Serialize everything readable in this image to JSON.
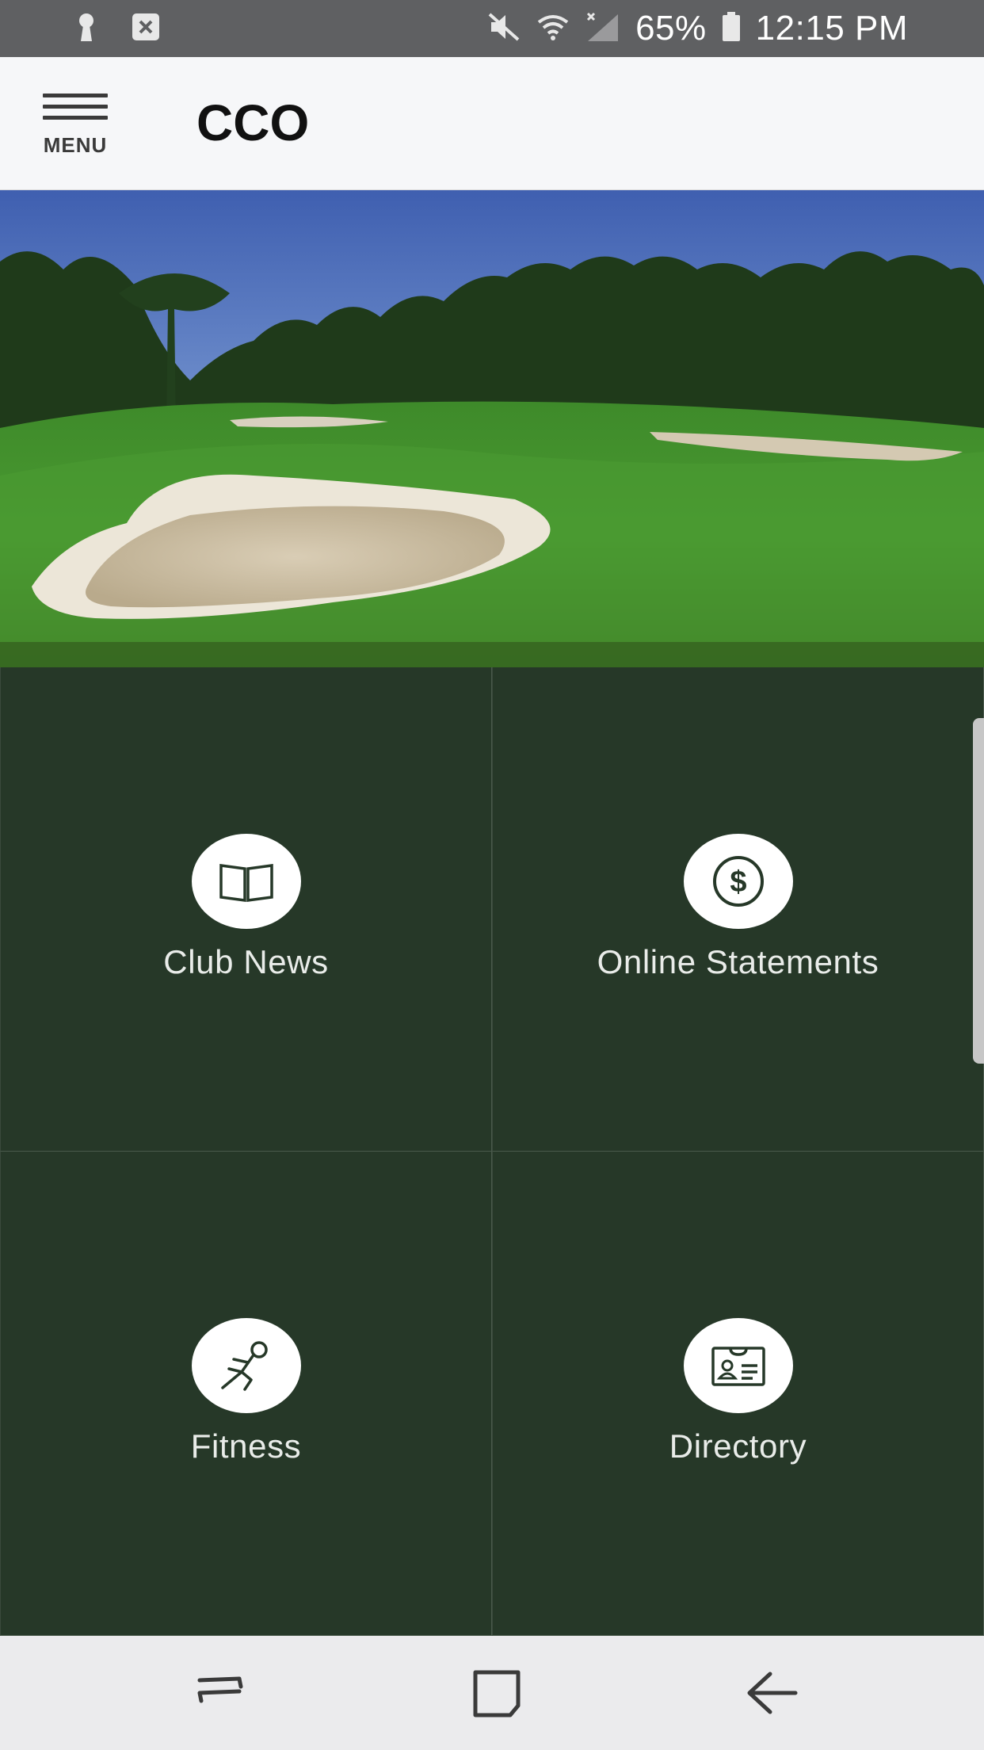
{
  "status_bar": {
    "battery": "65%",
    "time": "12:15 PM"
  },
  "header": {
    "menu_label": "MENU",
    "title": "CCO"
  },
  "tiles": [
    {
      "label": "Club News",
      "icon": "book-icon"
    },
    {
      "label": "Online Statements",
      "icon": "dollar-icon"
    },
    {
      "label": "Fitness",
      "icon": "runner-icon"
    },
    {
      "label": "Directory",
      "icon": "id-card-icon"
    }
  ],
  "colors": {
    "tile_bg": "#263828",
    "header_bg": "#f6f7f9",
    "status_bg": "#5f6062",
    "nav_bg": "#ebebed"
  }
}
